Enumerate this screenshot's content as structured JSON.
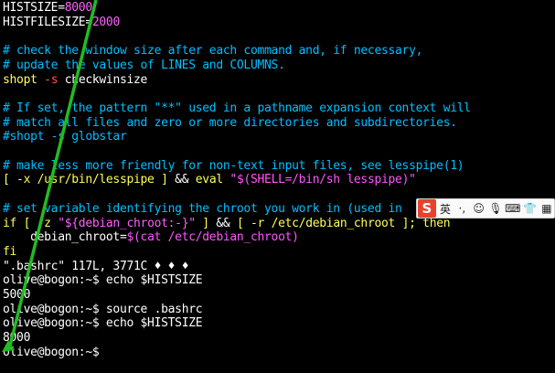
{
  "terminal": {
    "lines": [
      {
        "segments": [
          {
            "t": "HISTSIZE=",
            "c": "c-fg"
          },
          {
            "t": "8000",
            "c": "c-num"
          }
        ]
      },
      {
        "segments": [
          {
            "t": "HISTFILESIZE=",
            "c": "c-fg"
          },
          {
            "t": "2000",
            "c": "c-num"
          }
        ]
      },
      {
        "segments": []
      },
      {
        "segments": [
          {
            "t": "# check the window size after each command and, if necessary,",
            "c": "c-cmt"
          }
        ]
      },
      {
        "segments": [
          {
            "t": "# update the values of LINES and COLUMNS.",
            "c": "c-cmt"
          }
        ]
      },
      {
        "segments": [
          {
            "t": "shopt ",
            "c": "c-yel"
          },
          {
            "t": "-s",
            "c": "c-opt"
          },
          {
            "t": " checkwinsize",
            "c": "c-fg"
          }
        ]
      },
      {
        "segments": []
      },
      {
        "segments": [
          {
            "t": "# If set, the pattern \"**\" used in a pathname expansion context will",
            "c": "c-cmt"
          }
        ]
      },
      {
        "segments": [
          {
            "t": "# match all files and zero or more directories and subdirectories.",
            "c": "c-cmt"
          }
        ]
      },
      {
        "segments": [
          {
            "t": "#shopt -s globstar",
            "c": "c-cmt"
          }
        ]
      },
      {
        "segments": []
      },
      {
        "segments": [
          {
            "t": "# make less more friendly for non-text input files, see lesspipe(1)",
            "c": "c-cmt"
          }
        ]
      },
      {
        "segments": [
          {
            "t": "[ -x /usr/bin/lesspipe ] ",
            "c": "c-yel"
          },
          {
            "t": "&& ",
            "c": "c-fg"
          },
          {
            "t": "eval ",
            "c": "c-yel"
          },
          {
            "t": "\"",
            "c": "c-str"
          },
          {
            "t": "$(SHELL=/bin/sh lesspipe)",
            "c": "c-sub"
          },
          {
            "t": "\"",
            "c": "c-str"
          }
        ]
      },
      {
        "segments": []
      },
      {
        "segments": [
          {
            "t": "# set variable identifying the chroot you work in (used in",
            "c": "c-cmt"
          }
        ]
      },
      {
        "segments": [
          {
            "t": "if [ -z ",
            "c": "c-yel"
          },
          {
            "t": "\"${debian_chroot:-}\"",
            "c": "c-str"
          },
          {
            "t": " ] ",
            "c": "c-yel"
          },
          {
            "t": "&& ",
            "c": "c-fg"
          },
          {
            "t": "[ -r /etc/debian_chroot ]; then",
            "c": "c-yel"
          }
        ]
      },
      {
        "segments": [
          {
            "t": "    debian_chroot=",
            "c": "c-fg"
          },
          {
            "t": "$(cat /etc/debian_chroot)",
            "c": "c-sub"
          }
        ]
      },
      {
        "segments": [
          {
            "t": "fi",
            "c": "c-yel"
          }
        ]
      },
      {
        "segments": [
          {
            "t": "\".bashrc\" 117L, 3771C ♦ ♦ ♦",
            "c": "c-fg"
          }
        ]
      },
      {
        "segments": [
          {
            "t": "olive@bogon:~$ echo $HISTSIZE",
            "c": "c-fg"
          }
        ]
      },
      {
        "segments": [
          {
            "t": "5000",
            "c": "c-fg"
          }
        ]
      },
      {
        "segments": [
          {
            "t": "olive@bogon:~$ source .bashrc",
            "c": "c-fg"
          }
        ]
      },
      {
        "segments": [
          {
            "t": "olive@bogon:~$ echo $HISTSIZE",
            "c": "c-fg"
          }
        ]
      },
      {
        "segments": [
          {
            "t": "8000",
            "c": "c-fg"
          }
        ]
      },
      {
        "segments": [
          {
            "t": "olive@bogon:~$ ",
            "c": "c-fg"
          }
        ]
      }
    ]
  },
  "ime_toolbar": {
    "logo": "S",
    "lang_label": "英",
    "items": [
      {
        "icon": "moon-punct-icon",
        "glyph": "·,"
      },
      {
        "icon": "smiley-icon",
        "glyph": "☺"
      },
      {
        "icon": "microphone-icon",
        "glyph": "🎙"
      },
      {
        "icon": "keyboard-icon",
        "glyph": "⌨"
      },
      {
        "icon": "shirt-icon",
        "glyph": "👕"
      },
      {
        "icon": "grid-icon",
        "glyph": "▦"
      }
    ]
  },
  "colors": {
    "background": "#000000",
    "arrow": "#22bb22"
  }
}
